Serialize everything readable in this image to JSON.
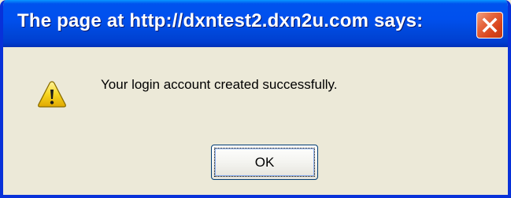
{
  "dialog": {
    "title": "The page at http://dxntest2.dxn2u.com says:",
    "message": "Your login account created successfully.",
    "ok_label": "OK"
  },
  "icons": {
    "close": "close-icon",
    "warning": "warning-icon"
  },
  "colors": {
    "titlebar": "#0054e3",
    "frame": "#0831d9",
    "dialog_bg": "#ece9d8",
    "close_button": "#e05a30",
    "warning_yellow": "#f5d21a"
  }
}
